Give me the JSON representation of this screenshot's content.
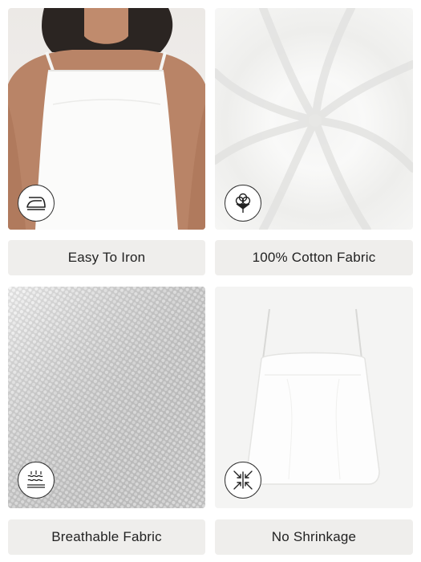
{
  "features": [
    {
      "label": "Easy To Iron",
      "icon": "iron-icon"
    },
    {
      "label": "100% Cotton Fabric",
      "icon": "cotton-boll-icon"
    },
    {
      "label": "Breathable Fabric",
      "icon": "breathable-waves-icon"
    },
    {
      "label": "No Shrinkage",
      "icon": "no-shrink-arrows-icon"
    }
  ],
  "colors": {
    "label_background": "#efeeec",
    "text": "#222222",
    "garment": "#ffffff"
  }
}
